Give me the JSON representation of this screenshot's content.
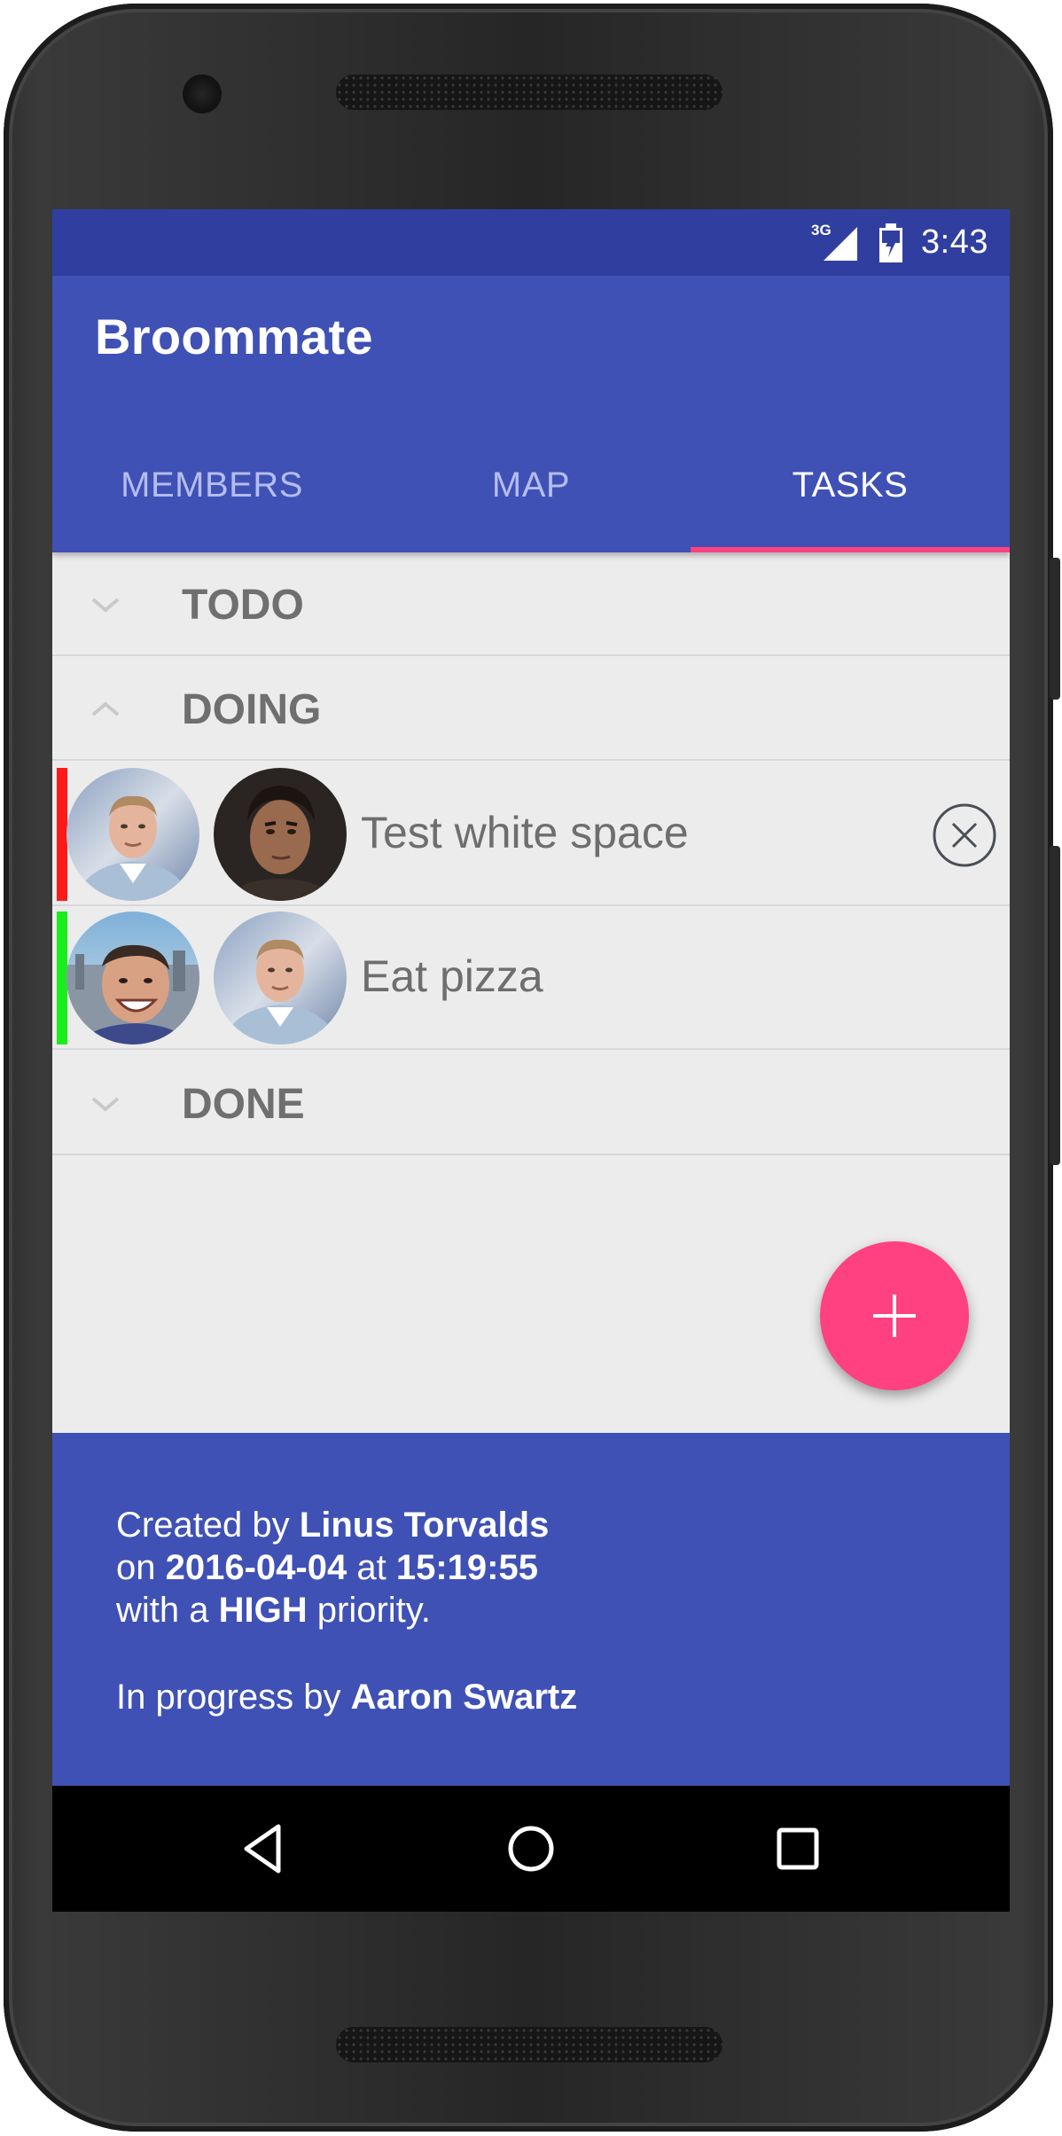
{
  "colors": {
    "primary": "#3f51b5",
    "primary_dark": "#303f9f",
    "accent": "#ff4081",
    "priority_high": "#ff1a1a",
    "priority_low": "#1aee1a"
  },
  "status_bar": {
    "network": "3G",
    "clock": "3:43",
    "icons": [
      "signal-icon",
      "battery-charging-icon"
    ]
  },
  "app": {
    "title": "Broommate"
  },
  "tabs": [
    {
      "label": "MEMBERS",
      "active": false
    },
    {
      "label": "MAP",
      "active": false
    },
    {
      "label": "TASKS",
      "active": true
    }
  ],
  "sections": {
    "todo": {
      "label": "TODO",
      "expanded": false,
      "icon": "chevron-down-icon"
    },
    "doing": {
      "label": "DOING",
      "expanded": true,
      "icon": "chevron-up-icon"
    },
    "done": {
      "label": "DONE",
      "expanded": false,
      "icon": "chevron-down-icon"
    }
  },
  "tasks": [
    {
      "title": "Test white space",
      "priority_color": "#ff1a1a",
      "avatars": [
        "avatar-linus",
        "avatar-aaron"
      ],
      "action_icon": "cancel-circle-icon"
    },
    {
      "title": "Eat pizza",
      "priority_color": "#1aee1a",
      "avatars": [
        "avatar-selfie-user",
        "avatar-linus"
      ]
    }
  ],
  "fab": {
    "icon": "plus-icon"
  },
  "details": {
    "created_prefix": "Created by",
    "creator": "Linus Torvalds",
    "on_prefix": "on",
    "date": "2016-04-04",
    "at_word": "at",
    "time": "15:19:55",
    "with_prefix": "with a",
    "priority": "HIGH",
    "priority_suffix": "priority.",
    "progress_prefix": "In progress by",
    "assignee": "Aaron Swartz"
  },
  "nav_bar": {
    "icons": [
      "back-icon",
      "home-icon",
      "recents-icon"
    ]
  }
}
